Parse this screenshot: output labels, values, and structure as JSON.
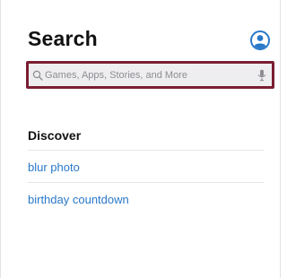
{
  "header": {
    "title": "Search",
    "account_icon": "person-circle-icon",
    "accent_color": "#2a78c8"
  },
  "search": {
    "placeholder": "Games, Apps, Stories, and More",
    "left_icon": "search-icon",
    "right_icon": "microphone-icon",
    "highlight_color": "#7a1e32"
  },
  "discover": {
    "title": "Discover",
    "items": [
      {
        "label": "blur photo"
      },
      {
        "label": "birthday countdown"
      }
    ]
  }
}
